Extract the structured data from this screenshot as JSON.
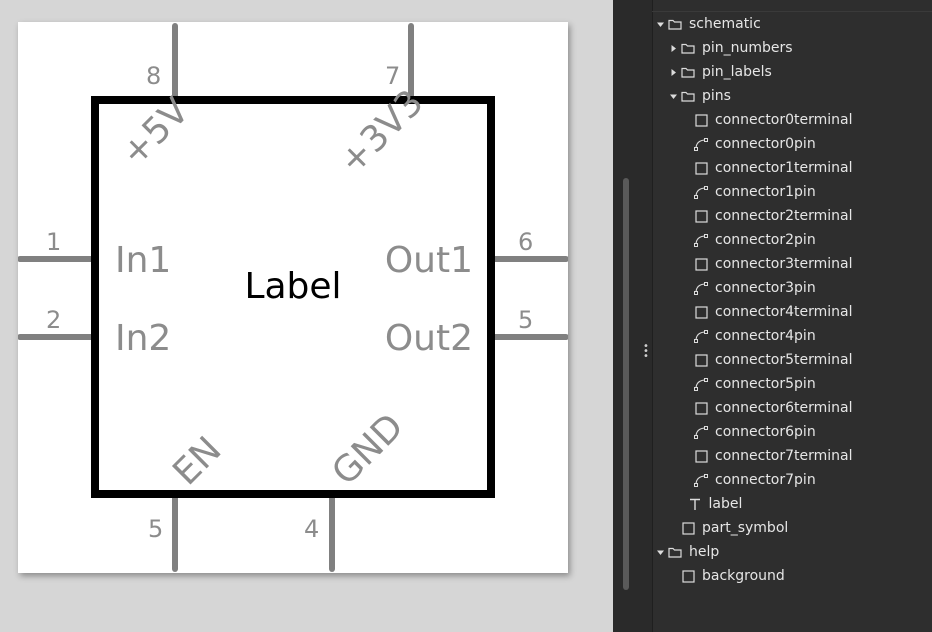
{
  "colors": {
    "canvas_bg": "#d6d6d6",
    "artboard_bg": "#ffffff",
    "symbol_stroke": "#000000",
    "pin_color": "#808080",
    "pin_text": "#8c8c8c",
    "label_text": "#000000",
    "panel_bg": "#2e2e2e",
    "panel_text": "#e6e6e6"
  },
  "schematic": {
    "center_label": "Label",
    "pins": [
      {
        "number": "8",
        "name": "+5V",
        "side": "top"
      },
      {
        "number": "7",
        "name": "+3V3",
        "side": "top"
      },
      {
        "number": "1",
        "name": "In1",
        "side": "left"
      },
      {
        "number": "2",
        "name": "In2",
        "side": "left"
      },
      {
        "number": "6",
        "name": "Out1",
        "side": "right"
      },
      {
        "number": "5",
        "name": "Out2",
        "side": "right"
      },
      {
        "number": "5",
        "name": "EN",
        "side": "bottom"
      },
      {
        "number": "4",
        "name": "GND",
        "side": "bottom"
      }
    ]
  },
  "layers": {
    "items": [
      {
        "label": "schematic",
        "depth": 0,
        "arrow": "expanded",
        "icon": "folder-icon"
      },
      {
        "label": "pin_numbers",
        "depth": 1,
        "arrow": "collapsed",
        "icon": "folder-icon"
      },
      {
        "label": "pin_labels",
        "depth": 1,
        "arrow": "collapsed",
        "icon": "folder-icon"
      },
      {
        "label": "pins",
        "depth": 1,
        "arrow": "expanded",
        "icon": "folder-icon"
      },
      {
        "label": "connector0terminal",
        "depth": 2,
        "arrow": "none",
        "icon": "rect-icon"
      },
      {
        "label": "connector0pin",
        "depth": 2,
        "arrow": "none",
        "icon": "path-icon"
      },
      {
        "label": "connector1terminal",
        "depth": 2,
        "arrow": "none",
        "icon": "rect-icon"
      },
      {
        "label": "connector1pin",
        "depth": 2,
        "arrow": "none",
        "icon": "path-icon"
      },
      {
        "label": "connector2terminal",
        "depth": 2,
        "arrow": "none",
        "icon": "rect-icon"
      },
      {
        "label": "connector2pin",
        "depth": 2,
        "arrow": "none",
        "icon": "path-icon"
      },
      {
        "label": "connector3terminal",
        "depth": 2,
        "arrow": "none",
        "icon": "rect-icon"
      },
      {
        "label": "connector3pin",
        "depth": 2,
        "arrow": "none",
        "icon": "path-icon"
      },
      {
        "label": "connector4terminal",
        "depth": 2,
        "arrow": "none",
        "icon": "rect-icon"
      },
      {
        "label": "connector4pin",
        "depth": 2,
        "arrow": "none",
        "icon": "path-icon"
      },
      {
        "label": "connector5terminal",
        "depth": 2,
        "arrow": "none",
        "icon": "rect-icon"
      },
      {
        "label": "connector5pin",
        "depth": 2,
        "arrow": "none",
        "icon": "path-icon"
      },
      {
        "label": "connector6terminal",
        "depth": 2,
        "arrow": "none",
        "icon": "rect-icon"
      },
      {
        "label": "connector6pin",
        "depth": 2,
        "arrow": "none",
        "icon": "path-icon"
      },
      {
        "label": "connector7terminal",
        "depth": 2,
        "arrow": "none",
        "icon": "rect-icon"
      },
      {
        "label": "connector7pin",
        "depth": 2,
        "arrow": "none",
        "icon": "path-icon"
      },
      {
        "label": "label",
        "depth": 1.5,
        "arrow": "none",
        "icon": "text-icon"
      },
      {
        "label": "part_symbol",
        "depth": 1,
        "arrow": "none",
        "icon": "rect-icon"
      },
      {
        "label": "help",
        "depth": 0,
        "arrow": "expanded",
        "icon": "folder-icon"
      },
      {
        "label": "background",
        "depth": 1,
        "arrow": "none",
        "icon": "rect-icon"
      }
    ]
  }
}
